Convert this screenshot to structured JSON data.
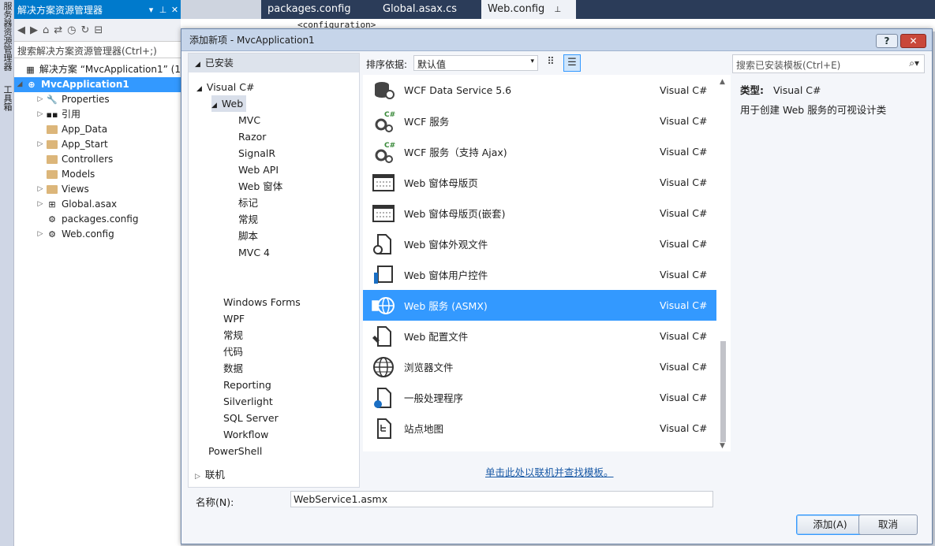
{
  "left_strip": {
    "tab1": "服务器资源管理器",
    "tab2": "工具箱"
  },
  "solution_explorer": {
    "title": "解决方案资源管理器",
    "search_placeholder": "搜索解决方案资源管理器(Ctrl+;)",
    "solution": "解决方案 “MvcApplication1” (1",
    "project": "MvcApplication1",
    "items": [
      "Properties",
      "引用",
      "App_Data",
      "App_Start",
      "Controllers",
      "Models",
      "Views",
      "Global.asax",
      "packages.config",
      "Web.config"
    ]
  },
  "editor": {
    "tabs": [
      "packages.config",
      "Global.asax.cs",
      "Web.config"
    ],
    "code_line": "<configuration>"
  },
  "dialog": {
    "title": "添加新项 - MvcApplication1",
    "help": "?",
    "installed": "已安装",
    "tree": {
      "visual_csharp": "Visual C#",
      "web": "Web",
      "web_children": [
        "MVC",
        "Razor",
        "SignalR",
        "Web API",
        "Web 窗体",
        "标记",
        "常规",
        "脚本",
        "MVC 4"
      ],
      "others": [
        "Windows Forms",
        "WPF",
        "常规",
        "代码",
        "数据",
        "Reporting",
        "Silverlight",
        "SQL Server",
        "Workflow"
      ],
      "powershell": "PowerShell",
      "online": "联机"
    },
    "sort_label": "排序依据:",
    "sort_value": "默认值",
    "search_placeholder": "搜索已安装模板(Ctrl+E)",
    "items": [
      {
        "name": "WCF Data Service 5.6",
        "lang": "Visual C#"
      },
      {
        "name": "WCF 服务",
        "lang": "Visual C#"
      },
      {
        "name": "WCF 服务（支持 Ajax)",
        "lang": "Visual C#"
      },
      {
        "name": "Web 窗体母版页",
        "lang": "Visual C#"
      },
      {
        "name": "Web 窗体母版页(嵌套)",
        "lang": "Visual C#"
      },
      {
        "name": "Web 窗体外观文件",
        "lang": "Visual C#"
      },
      {
        "name": "Web 窗体用户控件",
        "lang": "Visual C#"
      },
      {
        "name": "Web 服务 (ASMX)",
        "lang": "Visual C#"
      },
      {
        "name": "Web 配置文件",
        "lang": "Visual C#"
      },
      {
        "name": "浏览器文件",
        "lang": "Visual C#"
      },
      {
        "name": "一般处理程序",
        "lang": "Visual C#"
      },
      {
        "name": "站点地图",
        "lang": "Visual C#"
      }
    ],
    "details": {
      "type_label": "类型:",
      "type_value": "Visual C#",
      "description": "用于创建 Web 服务的可视设计类"
    },
    "online_link": "单击此处以联机并查找模板。",
    "name_label": "名称(N):",
    "name_value": "WebService1.asmx",
    "add_button": "添加(A)",
    "cancel_button": "取消"
  }
}
